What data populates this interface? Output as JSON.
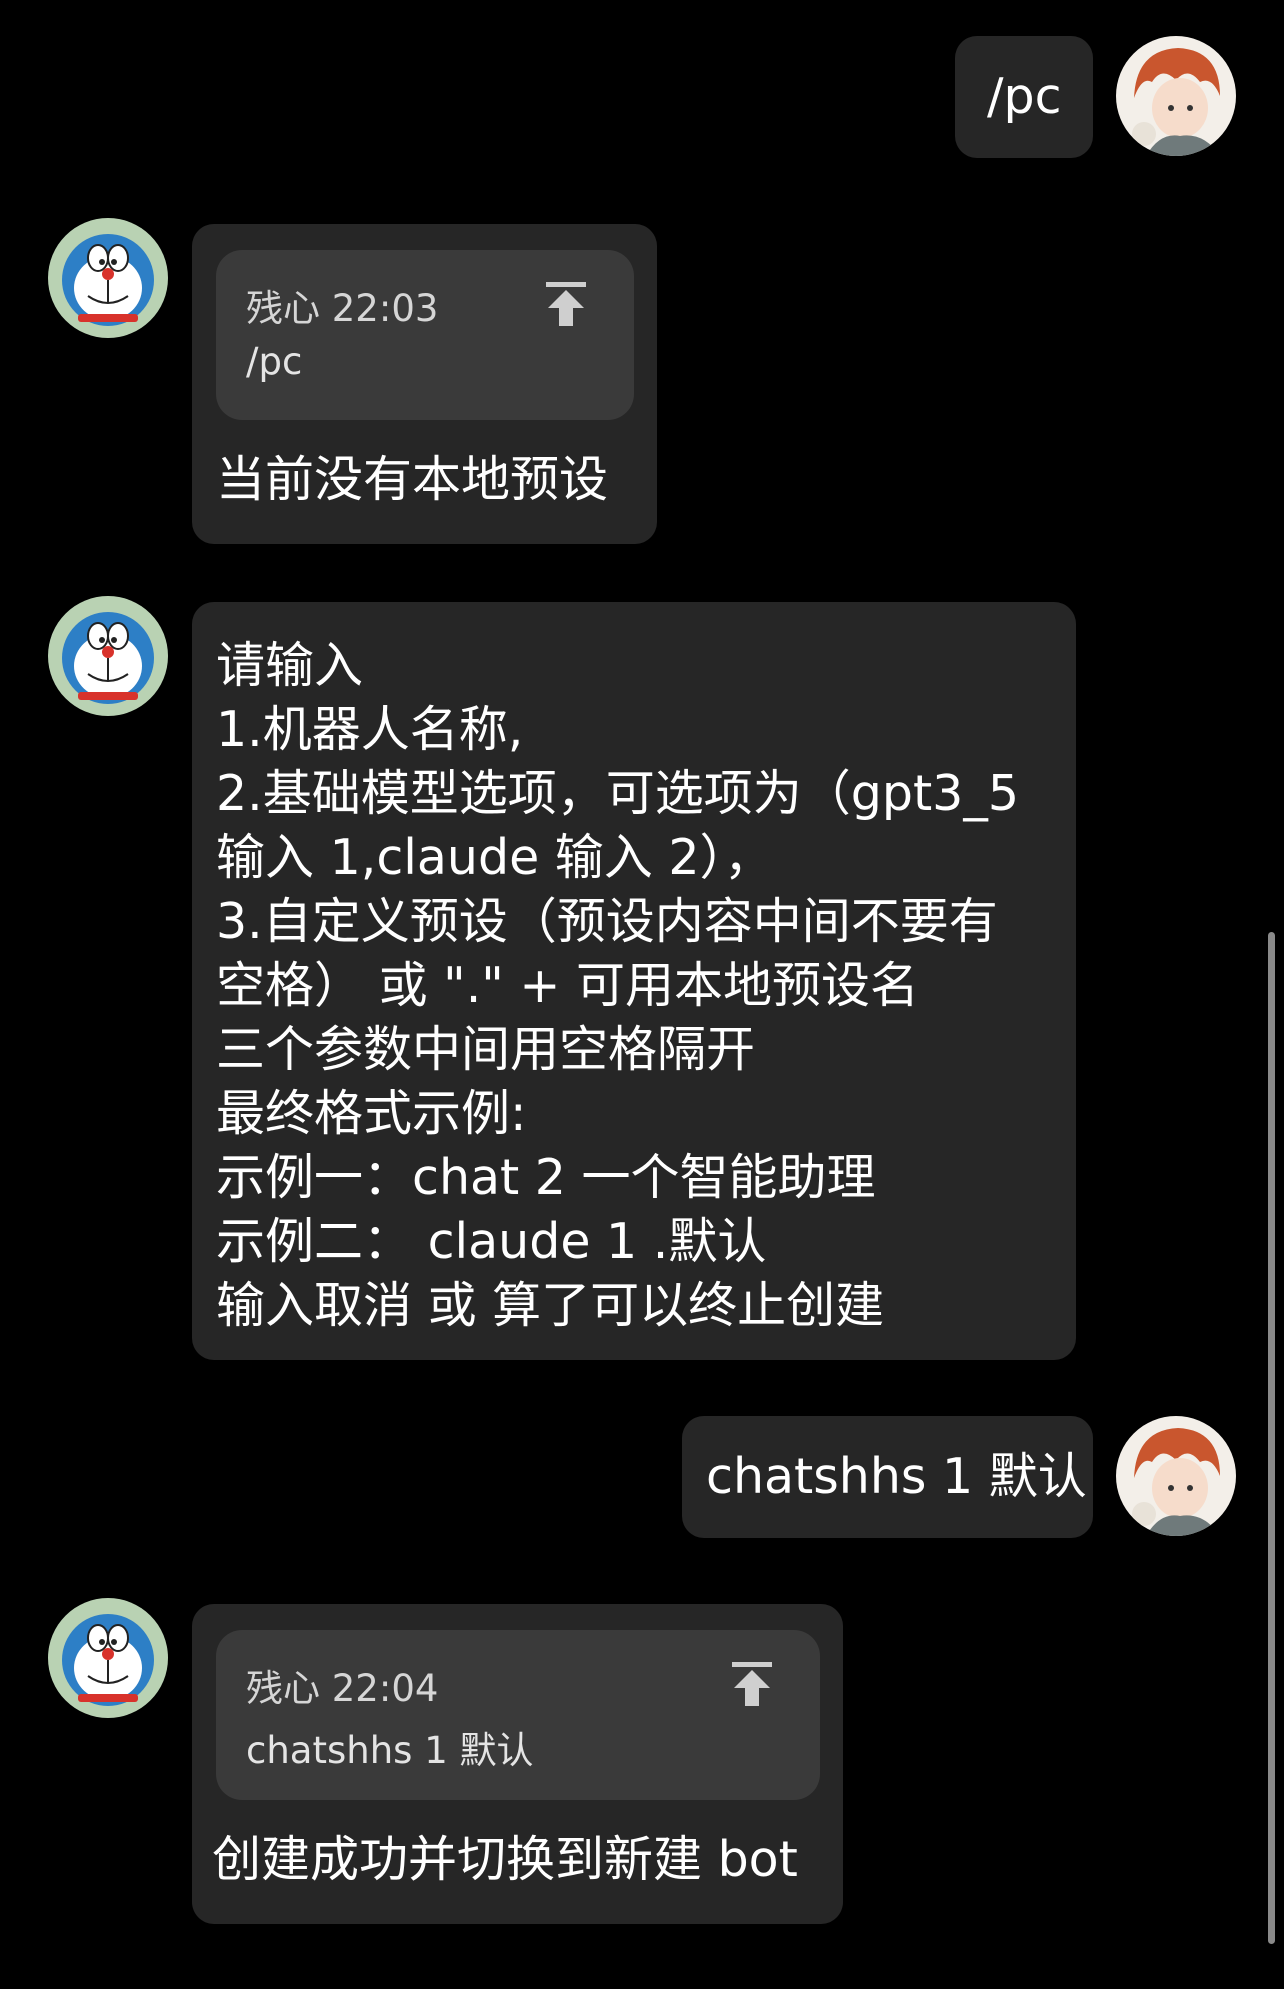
{
  "messages": [
    {
      "side": "right",
      "text": "/pc"
    },
    {
      "side": "left",
      "quote": {
        "sender": "残心",
        "time": "22:03",
        "text": "/pc"
      },
      "text": "当前没有本地预设"
    },
    {
      "side": "left",
      "lines": [
        "请输入",
        "1.机器人名称,",
        "2.基础模型选项，可选项为（gpt3_5",
        "输入 1,claude 输入 2），",
        "3.自定义预设（预设内容中间不要有",
        "空格） 或 \".\" + 可用本地预设名",
        "三个参数中间用空格隔开",
        "最终格式示例:",
        "示例一：chat 2 一个智能助理",
        "示例二： claude 1 .默认",
        "输入取消 或 算了可以终止创建"
      ]
    },
    {
      "side": "right",
      "text": "chatshhs 1 默认"
    },
    {
      "side": "left",
      "quote": {
        "sender": "残心",
        "time": "22:04",
        "text": "chatshhs 1 默认"
      },
      "text": "创建成功并切换到新建 bot"
    }
  ],
  "icons": {
    "quote_action": "arrow-to-top-icon",
    "bot_avatar": "doraemon-avatar",
    "user_avatar": "anime-boy-avatar"
  },
  "colors": {
    "background": "#000000",
    "bubble": "#262626",
    "quote_box": "#3a3a3a",
    "text": "#ffffff"
  }
}
